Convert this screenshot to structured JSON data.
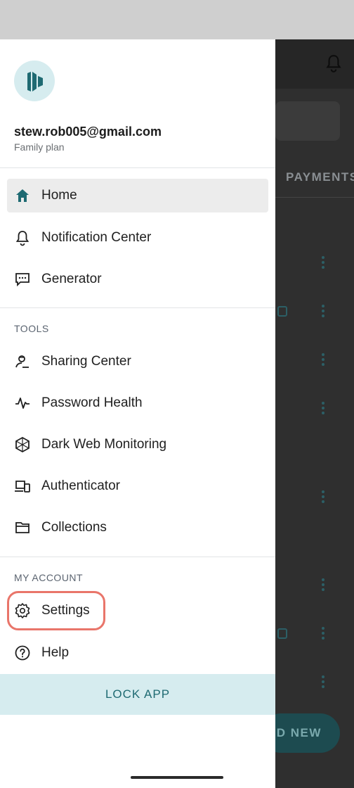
{
  "background_app": {
    "tab_label": "PAYMENTS",
    "fab_label": "DD NEW"
  },
  "account": {
    "email": "stew.rob005@gmail.com",
    "plan": "Family plan"
  },
  "nav_main": [
    {
      "label": "Home",
      "icon": "home-icon",
      "active": true
    },
    {
      "label": "Notification Center",
      "icon": "bell-icon"
    },
    {
      "label": "Generator",
      "icon": "generator-icon"
    }
  ],
  "tools": {
    "title": "TOOLS",
    "items": [
      {
        "label": "Sharing Center",
        "icon": "sharing-icon"
      },
      {
        "label": "Password Health",
        "icon": "pulse-icon"
      },
      {
        "label": "Dark Web Monitoring",
        "icon": "dark-web-icon"
      },
      {
        "label": "Authenticator",
        "icon": "authenticator-icon"
      },
      {
        "label": "Collections",
        "icon": "folder-icon"
      }
    ]
  },
  "my_account": {
    "title": "MY ACCOUNT",
    "items": [
      {
        "label": "Settings",
        "icon": "gear-icon",
        "highlighted": true
      },
      {
        "label": "Help",
        "icon": "help-icon"
      }
    ]
  },
  "lock_button": "LOCK APP",
  "colors": {
    "accent": "#1e6a72",
    "highlight": "#e9756a",
    "lock_bg": "#d6ecef"
  }
}
